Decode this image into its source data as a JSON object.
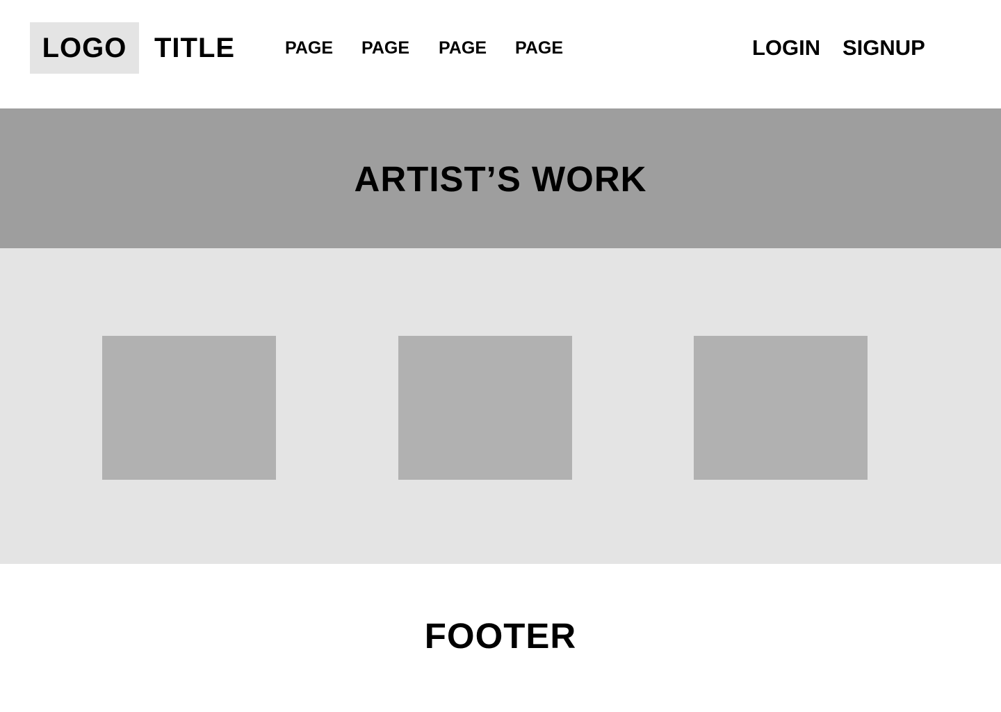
{
  "header": {
    "logo": "LOGO",
    "title": "TITLE",
    "nav": [
      {
        "label": "PAGE"
      },
      {
        "label": "PAGE"
      },
      {
        "label": "PAGE"
      },
      {
        "label": "PAGE"
      }
    ],
    "login_label": "LOGIN",
    "signup_label": "SIGNUP"
  },
  "hero": {
    "title": "ARTIST’S WORK"
  },
  "gallery": {
    "items": [
      {
        "kind": "image-placeholder"
      },
      {
        "kind": "image-placeholder"
      },
      {
        "kind": "image-placeholder"
      }
    ]
  },
  "footer": {
    "text": "FOOTER"
  },
  "colors": {
    "logo_bg": "#e4e4e4",
    "hero_bg": "#9e9e9e",
    "gallery_bg": "#e4e4e4",
    "placeholder": "#b1b1b1"
  }
}
